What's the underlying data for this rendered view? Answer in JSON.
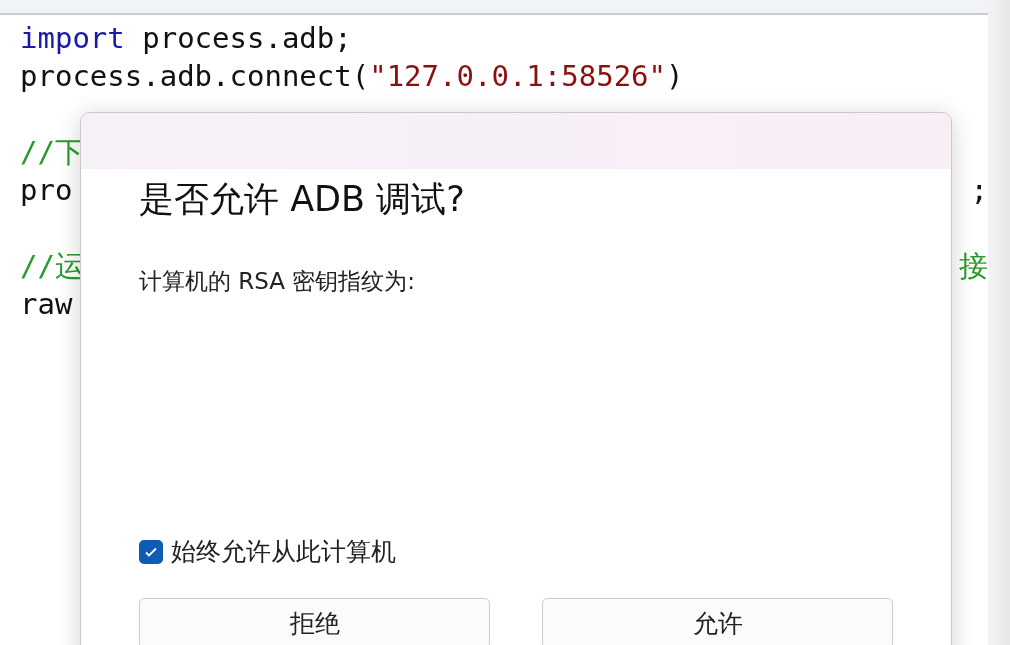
{
  "editor": {
    "lines": [
      {
        "tokens": [
          {
            "kind": "keyword",
            "text": "import"
          },
          {
            "kind": "plain",
            "text": " process.adb;"
          }
        ]
      },
      {
        "tokens": [
          {
            "kind": "plain",
            "text": "process.adb.connect("
          },
          {
            "kind": "string",
            "text": "\"127.0.0.1:58526\""
          },
          {
            "kind": "plain",
            "text": ")"
          }
        ]
      },
      {
        "blank_before": true,
        "tokens": [
          {
            "kind": "comment",
            "text": "//下"
          }
        ]
      },
      {
        "tokens": [
          {
            "kind": "plain",
            "text": "pro"
          }
        ],
        "right": [
          {
            "kind": "plain",
            "text": ";"
          }
        ]
      },
      {
        "blank_before": true,
        "tokens": [
          {
            "kind": "comment",
            "text": "//运"
          }
        ],
        "right": [
          {
            "kind": "comment",
            "text": "接"
          }
        ]
      },
      {
        "tokens": [
          {
            "kind": "plain",
            "text": "raw"
          }
        ]
      }
    ]
  },
  "dialog": {
    "title": "是否允许 ADB 调试?",
    "message": "计算机的 RSA 密钥指纹为:",
    "checkbox": {
      "label": "始终允许从此计算机",
      "checked": true
    },
    "buttons": [
      "拒绝",
      "允许"
    ]
  }
}
